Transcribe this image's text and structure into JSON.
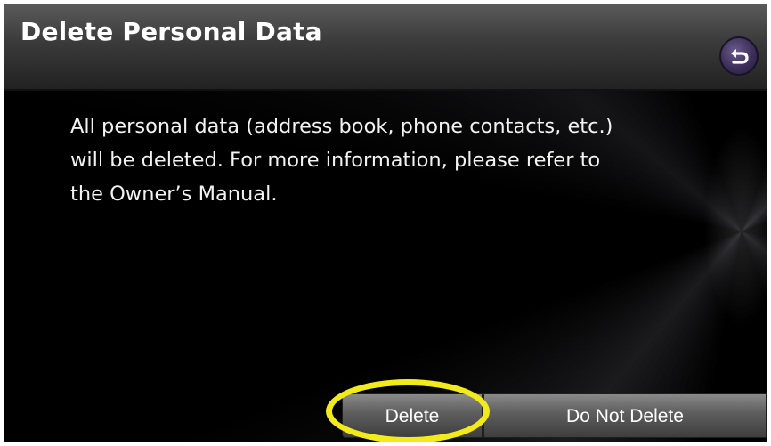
{
  "dialog": {
    "title": "Delete Personal Data",
    "message": "All personal data (address book, phone contacts, etc.)\nwill be deleted. For more information, please refer to\nthe Owner’s Manual.",
    "buttons": {
      "delete_label": "Delete",
      "do_not_delete_label": "Do Not Delete"
    },
    "back_icon": "back-arrow-icon"
  },
  "colors": {
    "background": "#000000",
    "title_text": "#ffffff",
    "back_button": "#3c2f5a",
    "highlight": "#f3ea1c"
  }
}
